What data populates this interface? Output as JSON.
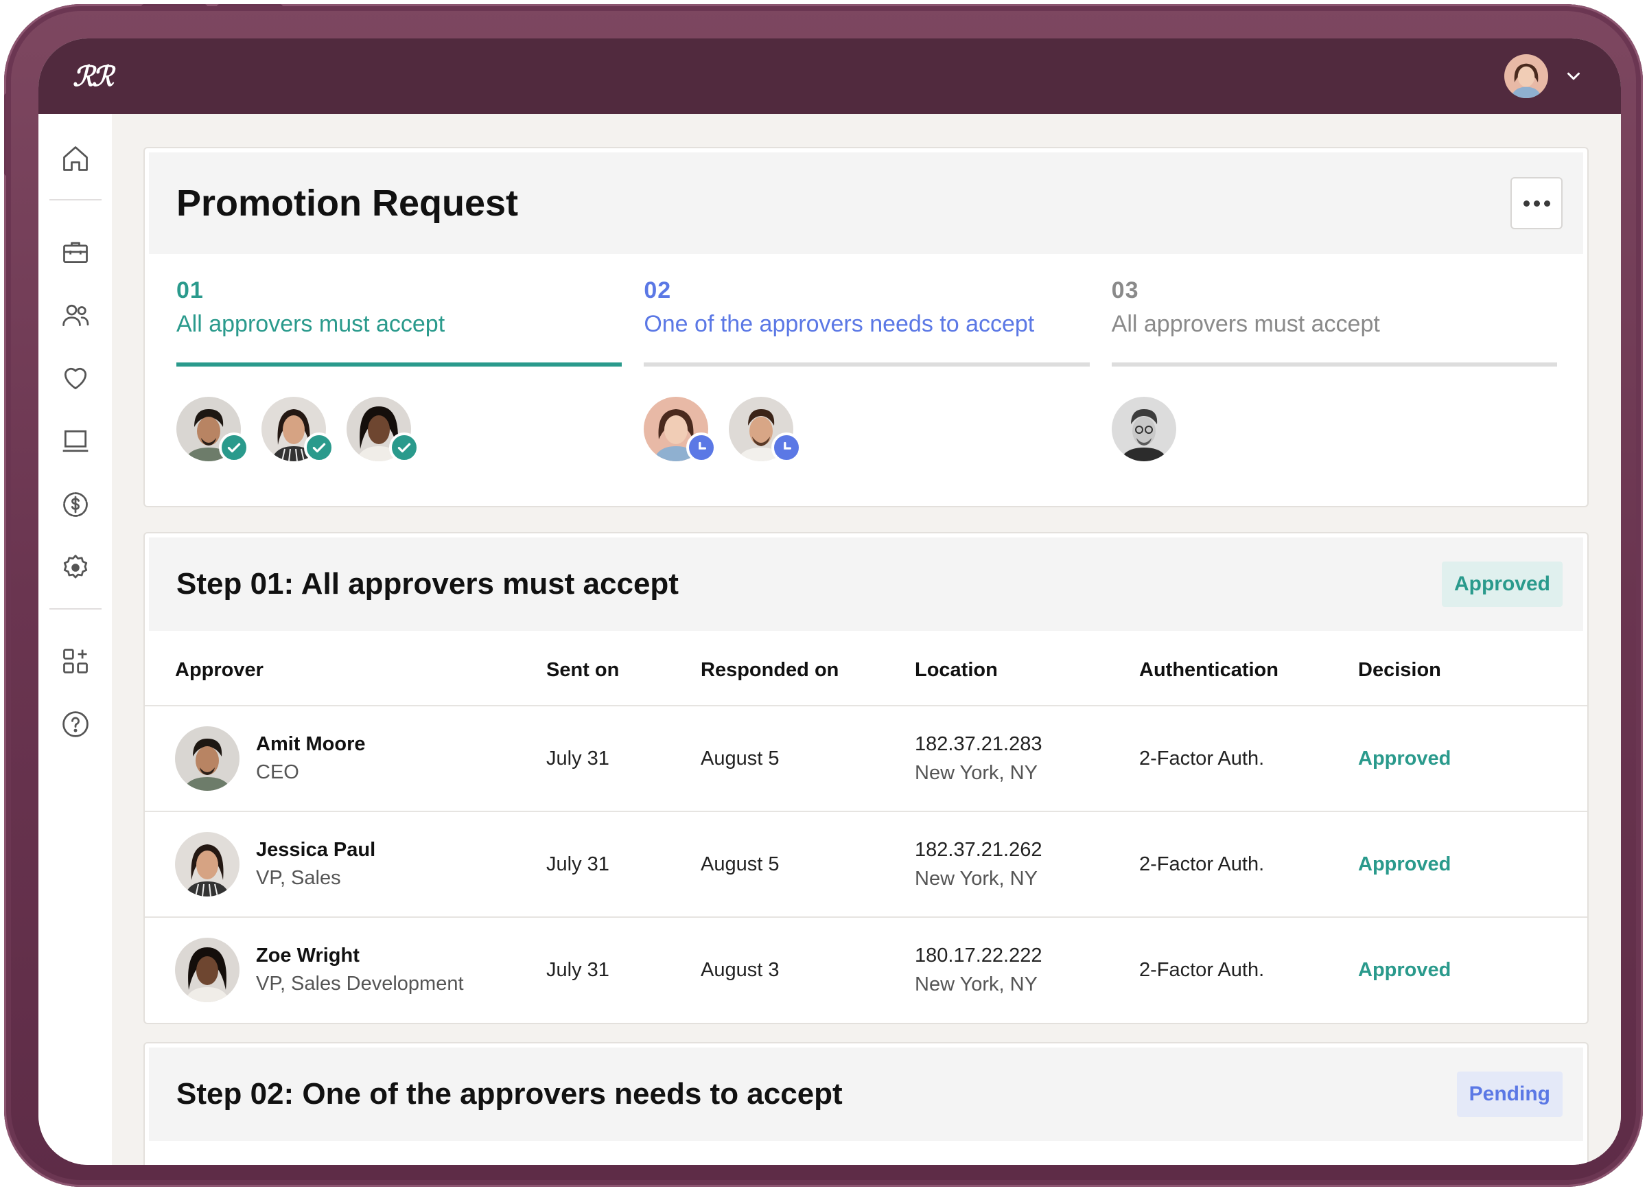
{
  "colors": {
    "frame": "#6b3652",
    "topbar": "#512a3e",
    "teal": "#2a9a8c",
    "blue": "#5b78e5",
    "gray": "#8a8a8a",
    "approved_bg": "#e0f0ee",
    "pending_bg": "#e4e9f8"
  },
  "topbar": {
    "logo_text": "ℛℛ",
    "user_menu_icon": "chevron-down-icon"
  },
  "sidebar": {
    "items": [
      "home-icon",
      "briefcase-icon",
      "people-icon",
      "heart-icon",
      "laptop-icon",
      "dollar-icon",
      "settings-icon",
      "apps-icon",
      "help-icon"
    ]
  },
  "request": {
    "title": "Promotion Request",
    "steps": [
      {
        "number": "01",
        "label": "All approvers must accept",
        "status": "approved",
        "approver_count": 3
      },
      {
        "number": "02",
        "label": "One of the approvers needs to accept",
        "status": "pending",
        "approver_count": 2
      },
      {
        "number": "03",
        "label": "All approvers must accept",
        "status": "not-started",
        "approver_count": 1
      }
    ]
  },
  "step1": {
    "title": "Step 01: All approvers must accept",
    "status": "Approved",
    "columns": [
      "Approver",
      "Sent on",
      "Responded on",
      "Location",
      "Authentication",
      "Decision"
    ],
    "rows": [
      {
        "name": "Amit Moore",
        "role": "CEO",
        "sent": "July 31",
        "responded": "August 5",
        "ip": "182.37.21.283",
        "city": "New York, NY",
        "auth": "2-Factor Auth.",
        "decision": "Approved"
      },
      {
        "name": "Jessica Paul",
        "role": "VP, Sales",
        "sent": "July 31",
        "responded": "August 5",
        "ip": "182.37.21.262",
        "city": "New York, NY",
        "auth": "2-Factor Auth.",
        "decision": "Approved"
      },
      {
        "name": "Zoe Wright",
        "role": "VP, Sales Development",
        "sent": "July 31",
        "responded": "August 3",
        "ip": "180.17.22.222",
        "city": "New York, NY",
        "auth": "2-Factor Auth.",
        "decision": "Approved"
      }
    ]
  },
  "step2": {
    "title": "Step 02: One of the approvers needs to accept",
    "status": "Pending"
  }
}
